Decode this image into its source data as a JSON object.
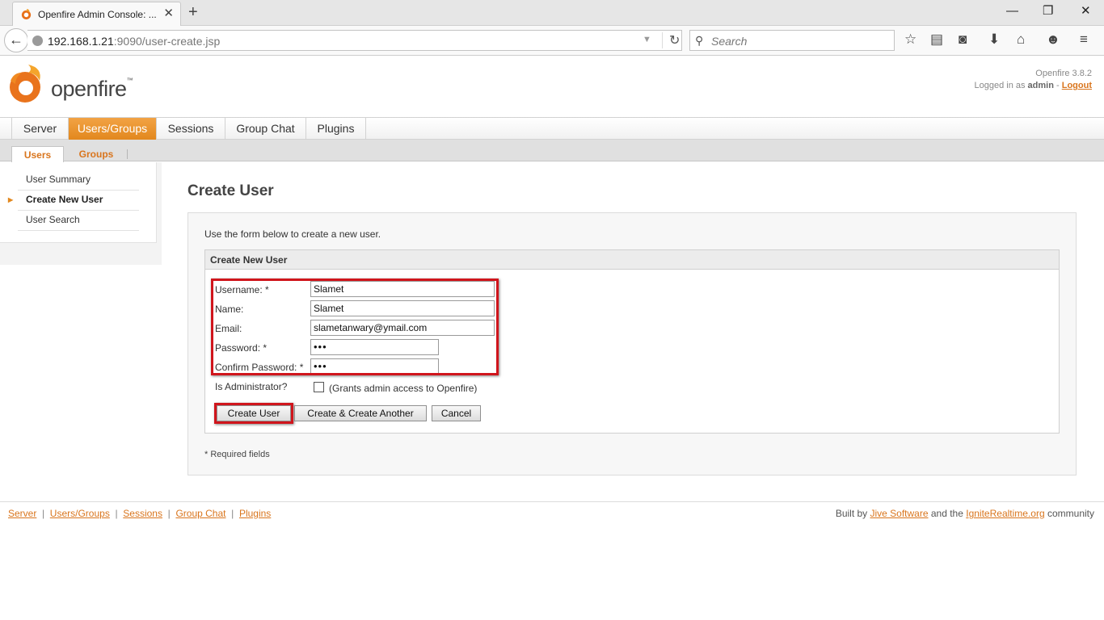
{
  "browser": {
    "tab_title": "Openfire Admin Console: ...",
    "url_host": "192.168.1.21",
    "url_rest": ":9090/user-create.jsp",
    "search_placeholder": "Search"
  },
  "header": {
    "logo_text": "openfire",
    "logo_tm": "™",
    "version": "Openfire 3.8.2",
    "logged_in_prefix": "Logged in as ",
    "user": "admin",
    "logged_in_sep": " - ",
    "logout": "Logout"
  },
  "nav": {
    "tabs": [
      {
        "label": "Server"
      },
      {
        "label": "Users/Groups"
      },
      {
        "label": "Sessions"
      },
      {
        "label": "Group Chat"
      },
      {
        "label": "Plugins"
      }
    ],
    "subtabs": [
      {
        "label": "Users"
      },
      {
        "label": "Groups"
      }
    ]
  },
  "sidebar": {
    "items": [
      {
        "label": "User Summary"
      },
      {
        "label": "Create New User"
      },
      {
        "label": "User Search"
      }
    ]
  },
  "content": {
    "title": "Create User",
    "intro": "Use the form below to create a new user.",
    "panel_title": "Create New User",
    "fields": {
      "username": {
        "label": "Username: *",
        "value": "Slamet"
      },
      "name": {
        "label": "Name:",
        "value": "Slamet"
      },
      "email": {
        "label": "Email:",
        "value": "slametanwary@ymail.com"
      },
      "password": {
        "label": "Password: *",
        "value": "•••"
      },
      "confirm": {
        "label": "Confirm Password: *",
        "value": "•••"
      },
      "admin": {
        "label": "Is Administrator?",
        "note": "(Grants admin access to Openfire)"
      }
    },
    "buttons": {
      "create": "Create User",
      "create_another": "Create & Create Another",
      "cancel": "Cancel"
    },
    "required_note": "* Required fields"
  },
  "footer": {
    "links": [
      {
        "label": "Server"
      },
      {
        "label": "Users/Groups"
      },
      {
        "label": "Sessions"
      },
      {
        "label": "Group Chat"
      },
      {
        "label": "Plugins"
      }
    ],
    "credit_prefix": "Built by ",
    "credit_link1": "Jive Software",
    "credit_mid": " and the ",
    "credit_link2": "IgniteRealtime.org",
    "credit_suffix": " community"
  },
  "colors": {
    "accent": "#e2881e",
    "link": "#d9751d",
    "highlight": "#d0151c"
  }
}
